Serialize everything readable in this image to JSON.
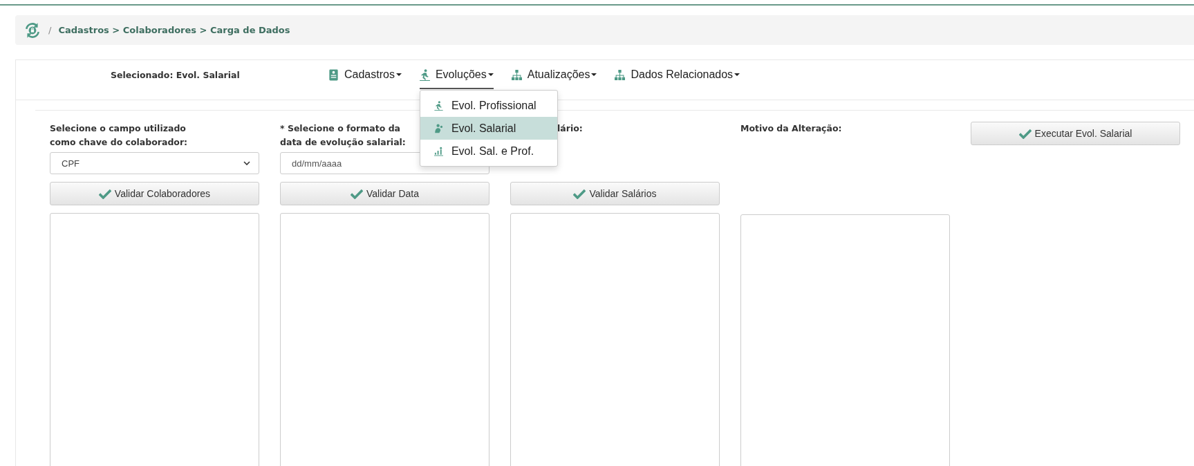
{
  "breadcrumb": {
    "separator": "/",
    "path": "Cadastros > Colaboradores > Carga de Dados"
  },
  "selected_label": "Selecionado: Evol. Salarial",
  "menu": [
    {
      "label": "Cadastros",
      "expanded": false
    },
    {
      "label": "Evoluções",
      "expanded": true
    },
    {
      "label": "Atualizações",
      "expanded": false
    },
    {
      "label": "Dados Relacionados",
      "expanded": false
    }
  ],
  "dropdown": [
    {
      "label": "Evol. Profissional",
      "selected": false
    },
    {
      "label": "Evol. Salarial",
      "selected": true
    },
    {
      "label": "Evol. Sal. e Prof.",
      "selected": false
    }
  ],
  "columns": [
    {
      "label": "Selecione o campo utilizado\ncomo chave do colaborador:",
      "kind": "select",
      "value": "CPF",
      "button": "Validar Colaboradores"
    },
    {
      "label": "* Selecione o formato da\ndata de evolução salarial:",
      "kind": "input",
      "placeholder": "dd/mm/aaaa",
      "button": "Validar Data"
    },
    {
      "label": "lário:",
      "kind": "hidden",
      "button": "Validar Salários"
    },
    {
      "label": "Motivo da Alteração:",
      "kind": "none"
    }
  ],
  "execute_button": "Executar Evol. Salarial"
}
